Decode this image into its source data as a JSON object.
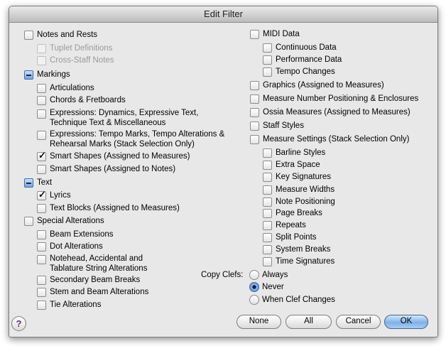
{
  "window": {
    "title": "Edit Filter"
  },
  "left": {
    "notes_and_rests": "Notes and Rests",
    "tuplet_definitions": "Tuplet Definitions",
    "cross_staff_notes": "Cross-Staff Notes",
    "markings": "Markings",
    "articulations": "Articulations",
    "chords_fretboards": "Chords & Fretboards",
    "expressions_dynamics": "Expressions: Dynamics, Expressive Text, Technique Text & Miscellaneous",
    "expressions_tempo": "Expressions: Tempo Marks, Tempo Alterations & Rehearsal Marks (Stack Selection Only)",
    "smart_shapes_measures": "Smart Shapes (Assigned to Measures)",
    "smart_shapes_notes": "Smart Shapes (Assigned to Notes)",
    "text": "Text",
    "lyrics": "Lyrics",
    "text_blocks": "Text Blocks (Assigned to Measures)",
    "special_alterations": "Special Alterations",
    "beam_extensions": "Beam Extensions",
    "dot_alterations": "Dot Alterations",
    "notehead_alterations": "Notehead, Accidental and Tablature String Alterations",
    "secondary_beam_breaks": "Secondary Beam Breaks",
    "stem_beam_alterations": "Stem and Beam Alterations",
    "tie_alterations": "Tie Alterations"
  },
  "right": {
    "midi_data": "MIDI Data",
    "continuous_data": "Continuous Data",
    "performance_data": "Performance Data",
    "tempo_changes": "Tempo Changes",
    "graphics": "Graphics (Assigned to Measures)",
    "measure_number_positioning": "Measure Number Positioning & Enclosures",
    "ossia_measures": "Ossia Measures (Assigned to Measures)",
    "staff_styles": "Staff Styles",
    "measure_settings": "Measure Settings (Stack Selection Only)",
    "barline_styles": "Barline Styles",
    "extra_space": "Extra Space",
    "key_signatures": "Key Signatures",
    "measure_widths": "Measure Widths",
    "note_positioning": "Note Positioning",
    "page_breaks": "Page Breaks",
    "repeats": "Repeats",
    "split_points": "Split Points",
    "system_breaks": "System Breaks",
    "time_signatures": "Time Signatures"
  },
  "copy_clefs": {
    "label": "Copy Clefs:",
    "always": "Always",
    "never": "Never",
    "when_clef_changes": "When Clef Changes",
    "selected": "Never"
  },
  "buttons": {
    "none": "None",
    "all": "All",
    "cancel": "Cancel",
    "ok": "OK"
  },
  "help": {
    "glyph": "?"
  },
  "checkmark": "✓",
  "colors": {
    "default_button": "#7eb1e8",
    "mixed_checkbox": "#3b6db1"
  }
}
